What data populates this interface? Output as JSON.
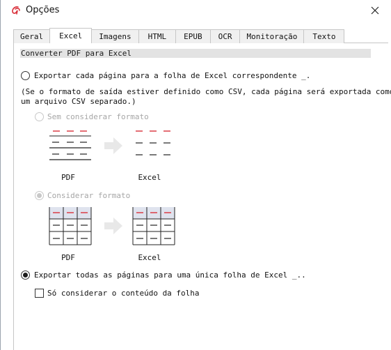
{
  "window": {
    "title": "Opções",
    "icon": "abbyy-logo-icon"
  },
  "tabs": [
    {
      "label": "Geral",
      "active": false
    },
    {
      "label": "Excel",
      "active": true
    },
    {
      "label": "Imagens",
      "active": false
    },
    {
      "label": "HTML",
      "active": false
    },
    {
      "label": "EPUB",
      "active": false
    },
    {
      "label": "OCR",
      "active": false
    },
    {
      "label": "Monitoração",
      "active": false
    },
    {
      "label": "Texto",
      "active": false
    }
  ],
  "excel": {
    "section_title": "Converter PDF para Excel",
    "option_per_page": {
      "label": "Exportar cada página para a folha de Excel correspondente  _.",
      "checked": false
    },
    "note_line1": "(Se o formato de saída estiver definido como CSV, cada página será exportada como",
    "note_line2": "um arquivo CSV separado.)",
    "sub_no_format": {
      "label": "Sem considerar formato",
      "checked": false,
      "enabled": false
    },
    "sub_format": {
      "label": "Considerar formato",
      "checked": true,
      "enabled": false
    },
    "illustration_pdf_caption": "PDF",
    "illustration_excel_caption": "Excel",
    "option_single_sheet": {
      "label": "Exportar todas as páginas para uma única folha de Excel  _..",
      "checked": true
    },
    "content_only": {
      "label": "Só considerar o conteúdo da folha",
      "checked": false
    }
  },
  "colors": {
    "accent_red": "#d9303a",
    "header_bg": "#e3e3e3",
    "grid_header_bg": "#dfe3ee",
    "disabled": "#a6a6a6"
  }
}
